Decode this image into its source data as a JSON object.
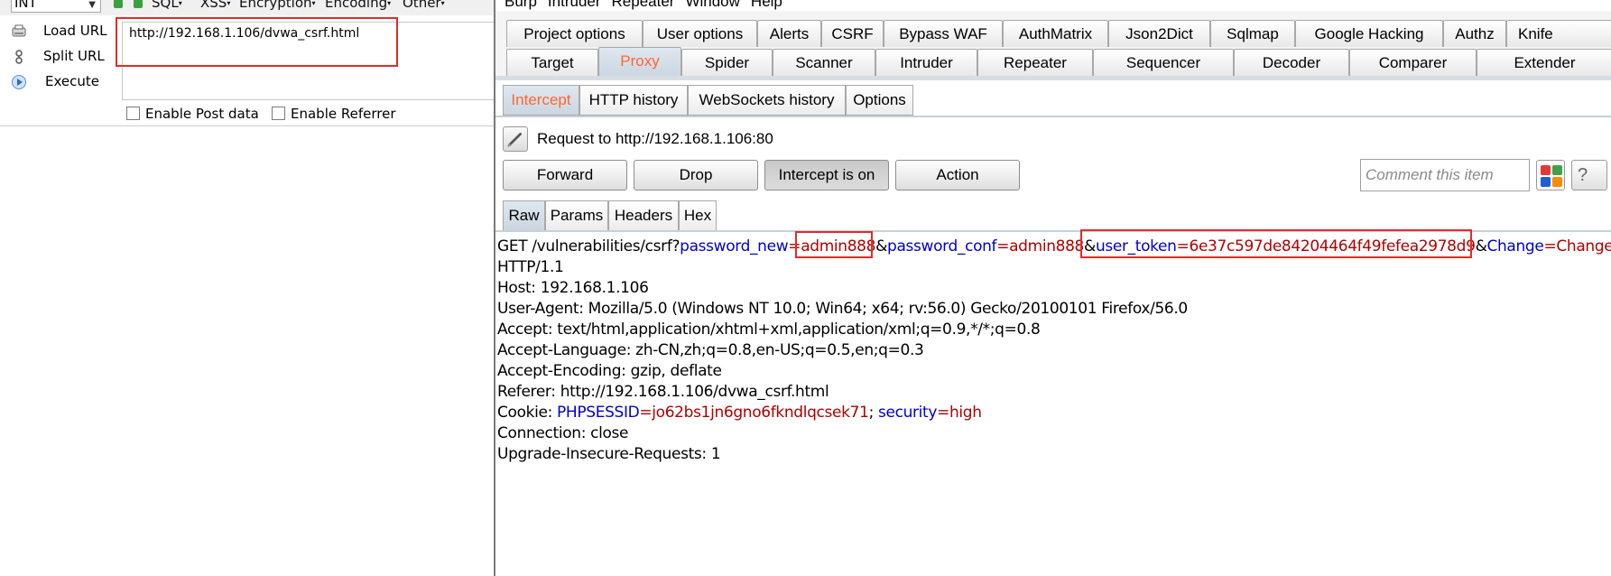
{
  "hackbar": {
    "select_value": "INT",
    "menus": [
      "SQL",
      "XSS",
      "Encryption",
      "Encoding",
      "Other"
    ],
    "load_url": "Load URL",
    "split_url": "Split URL",
    "execute": "Execute",
    "url_value": "http://192.168.1.106/dvwa_csrf.html",
    "enable_post": "Enable Post data",
    "enable_referrer": "Enable Referrer"
  },
  "burp": {
    "menubar": [
      "Burp",
      "Intruder",
      "Repeater",
      "Window",
      "Help"
    ],
    "tabs_row1": [
      "Project options",
      "User options",
      "Alerts",
      "CSRF",
      "Bypass WAF",
      "AuthMatrix",
      "Json2Dict",
      "Sqlmap",
      "Google Hacking",
      "Authz",
      "Knife"
    ],
    "tabs_row2": [
      "Target",
      "Proxy",
      "Spider",
      "Scanner",
      "Intruder",
      "Repeater",
      "Sequencer",
      "Decoder",
      "Comparer",
      "Extender"
    ],
    "active_tab": "Proxy",
    "proxy_subtabs": [
      "Intercept",
      "HTTP history",
      "WebSockets history",
      "Options"
    ],
    "active_subtab": "Intercept",
    "request_to": "Request to http://192.168.1.106:80",
    "buttons": {
      "forward": "Forward",
      "drop": "Drop",
      "intercept": "Intercept is on",
      "action": "Action"
    },
    "comment_placeholder": "Comment this item",
    "help_glyph": "?",
    "view_tabs": [
      "Raw",
      "Params",
      "Headers",
      "Hex"
    ],
    "active_view": "Raw",
    "request": {
      "line1": {
        "method_path": "GET /vulnerabilities/csrf?",
        "p1_name": "password_new",
        "p1_value": "admin888",
        "p2_name": "password_conf",
        "p2_value": "admin888",
        "p3_name": "user_token",
        "p3_value": "6e37c597de84204464f49fefea2978d9",
        "p4_name": "Change",
        "p4_value": "Change",
        "eq": "=",
        "amp": "&"
      },
      "line2": "HTTP/1.1",
      "host": "Host: 192.168.1.106",
      "user_agent": "User-Agent: Mozilla/5.0 (Windows NT 10.0; Win64; x64; rv:56.0) Gecko/20100101 Firefox/56.0",
      "accept": "Accept: text/html,application/xhtml+xml,application/xml;q=0.9,*/*;q=0.8",
      "accept_language": "Accept-Language: zh-CN,zh;q=0.8,en-US;q=0.5,en;q=0.3",
      "accept_encoding": "Accept-Encoding: gzip, deflate",
      "referer": "Referer: http://192.168.1.106/dvwa_csrf.html",
      "cookie": {
        "label": "Cookie: ",
        "n1": "PHPSESSID",
        "v1": "jo62bs1jn6gno6fkndlqcsek71",
        "sep": "; ",
        "n2": "security",
        "v2": "high"
      },
      "connection": "Connection: close",
      "upgrade": "Upgrade-Insecure-Requests: 1"
    }
  },
  "colors": {
    "highlight_red": "#e52a2a",
    "active_tab_text": "#ff6633",
    "param_name": "#0000cc",
    "param_value": "#b00000"
  }
}
